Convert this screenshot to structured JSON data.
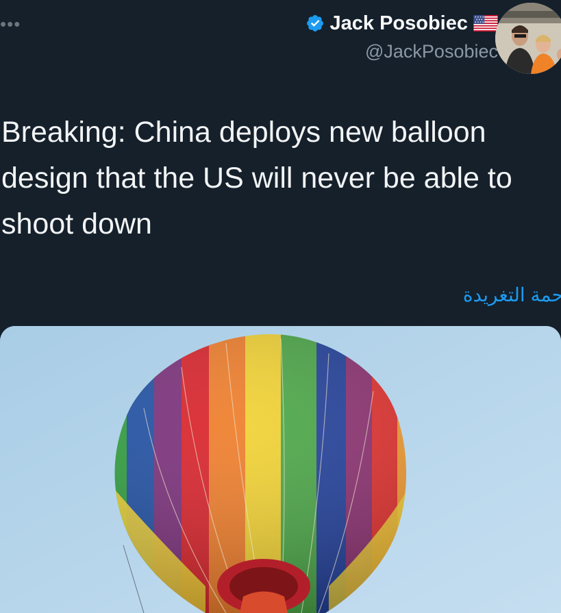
{
  "tweet": {
    "more_menu": "•••",
    "author_name": "Jack Posobiec",
    "author_handle": "@JackPosobiec",
    "text": "Breaking: China deploys new balloon design that the US will never be able to shoot down",
    "translate_link": "حمة التغريدة"
  },
  "icons": {
    "verified": "verified-badge-icon",
    "flag": "us-flag-icon",
    "more": "more-dots-icon"
  },
  "colors": {
    "background": "#15202b",
    "link": "#1d9bf0",
    "verified": "#1d9bf0",
    "sky": "#b9d7ea"
  }
}
